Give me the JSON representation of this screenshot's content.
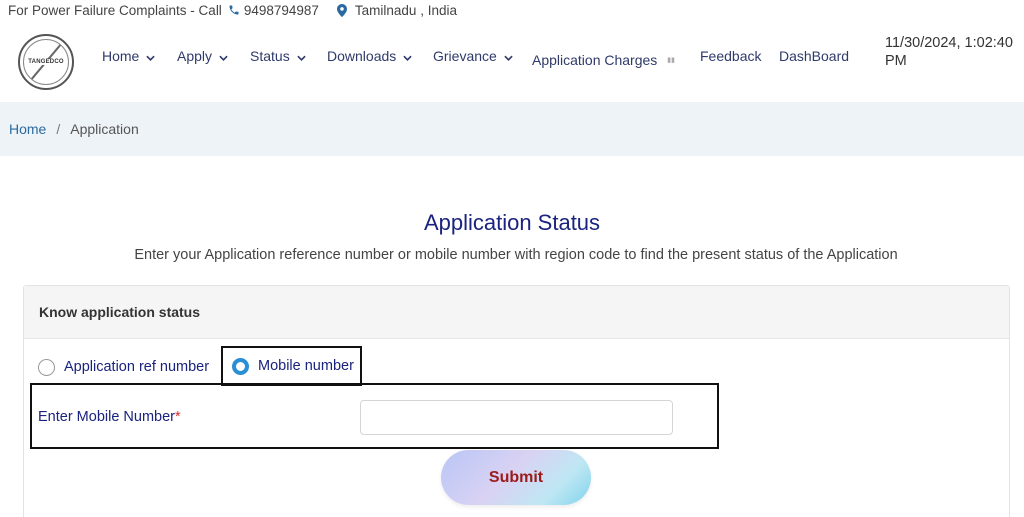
{
  "topbar": {
    "complaint_text": "For Power Failure Complaints - Call",
    "phone": "9498794987",
    "location": "Tamilnadu , India"
  },
  "header": {
    "logo_text": "TANGEDCO",
    "nav": {
      "home": "Home",
      "apply": "Apply",
      "status": "Status",
      "downloads": "Downloads",
      "grievance": "Grievance",
      "charges": "Application Charges",
      "feedback": "Feedback",
      "dashboard": "DashBoard"
    },
    "datetime_line1": "11/30/2024, 1:02:40",
    "datetime_line2": "PM"
  },
  "breadcrumb": {
    "home": "Home",
    "separator": "/",
    "current": "Application"
  },
  "main": {
    "title": "Application Status",
    "description": "Enter your Application reference number or mobile number with region code to find the present status of the Application"
  },
  "form": {
    "card_title": "Know application status",
    "option_ref": "Application ref number",
    "option_mobile": "Mobile number",
    "selected_option": "Mobile number",
    "mobile_label": "Enter Mobile Number",
    "required_mark": "*",
    "mobile_value": "",
    "submit_label": "Submit"
  },
  "colors": {
    "nav_text": "#2f3a6b",
    "title": "#1a237e",
    "radio_checked": "#2b8fd6",
    "submit_text": "#9b1b1b",
    "breadcrumb_bg": "#eef3f8"
  }
}
